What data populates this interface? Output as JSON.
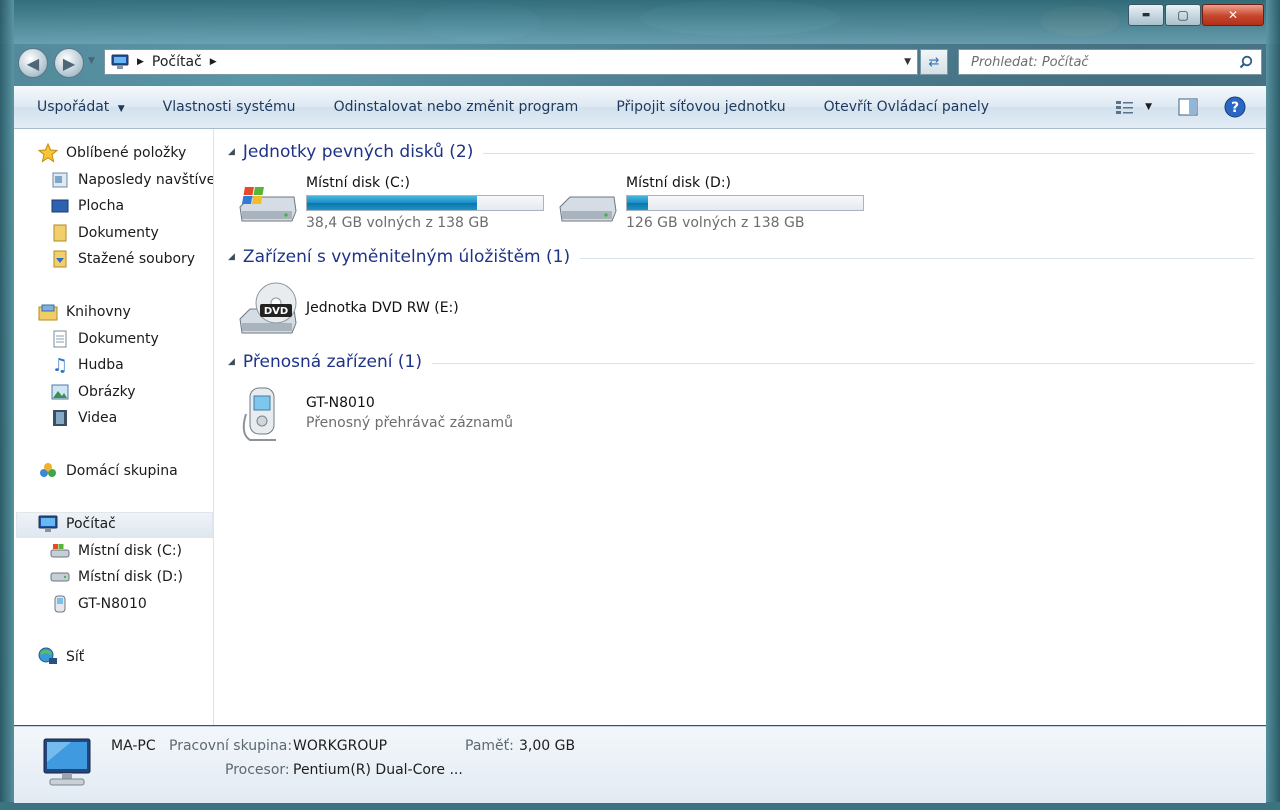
{
  "window": {
    "caption": {
      "minimize": "▬",
      "maximize": "▢",
      "close": "✕"
    }
  },
  "address_bar": {
    "location": "Počítač",
    "search_placeholder": "Prohledat: Počítač"
  },
  "command_bar": {
    "organize": "Uspořádat",
    "system_properties": "Vlastnosti systému",
    "uninstall": "Odinstalovat nebo změnit program",
    "map_drive": "Připojit síťovou jednotku",
    "control_panel": "Otevřít Ovládací panely"
  },
  "navigation": {
    "favorites": {
      "label": "Oblíbené položky",
      "items": [
        "Naposledy navštíver",
        "Plocha",
        "Dokumenty",
        "Stažené soubory"
      ]
    },
    "libraries": {
      "label": "Knihovny",
      "items": [
        "Dokumenty",
        "Hudba",
        "Obrázky",
        "Videa"
      ]
    },
    "homegroup": {
      "label": "Domácí skupina"
    },
    "computer": {
      "label": "Počítač",
      "items": [
        "Místní disk (C:)",
        "Místní disk (D:)",
        "GT-N8010"
      ]
    },
    "network": {
      "label": "Síť"
    }
  },
  "groups": {
    "hard_disks": {
      "title": "Jednotky pevných disků (2)",
      "drives": [
        {
          "name": "Místní disk (C:)",
          "free_text": "38,4 GB volných z 138 GB",
          "used_fraction": 0.72
        },
        {
          "name": "Místní disk (D:)",
          "free_text": "126 GB volných z 138 GB",
          "used_fraction": 0.09
        }
      ]
    },
    "removable": {
      "title": "Zařízení s vyměnitelným úložištěm (1)",
      "items": [
        {
          "name": "Jednotka DVD RW (E:)",
          "badge": "DVD"
        }
      ]
    },
    "portable": {
      "title": "Přenosná zařízení (1)",
      "items": [
        {
          "name": "GT-N8010",
          "subtitle": "Přenosný přehrávač záznamů"
        }
      ]
    }
  },
  "details": {
    "computer_name": "MA-PC",
    "workgroup_label": "Pracovní skupina:",
    "workgroup": "WORKGROUP",
    "memory_label": "Paměť:",
    "memory": "3,00 GB",
    "processor_label": "Procesor:",
    "processor": "Pentium(R) Dual-Core ..."
  },
  "colors": {
    "accent_heading": "#1e3287",
    "bar_fill": "#1c8cc6"
  }
}
